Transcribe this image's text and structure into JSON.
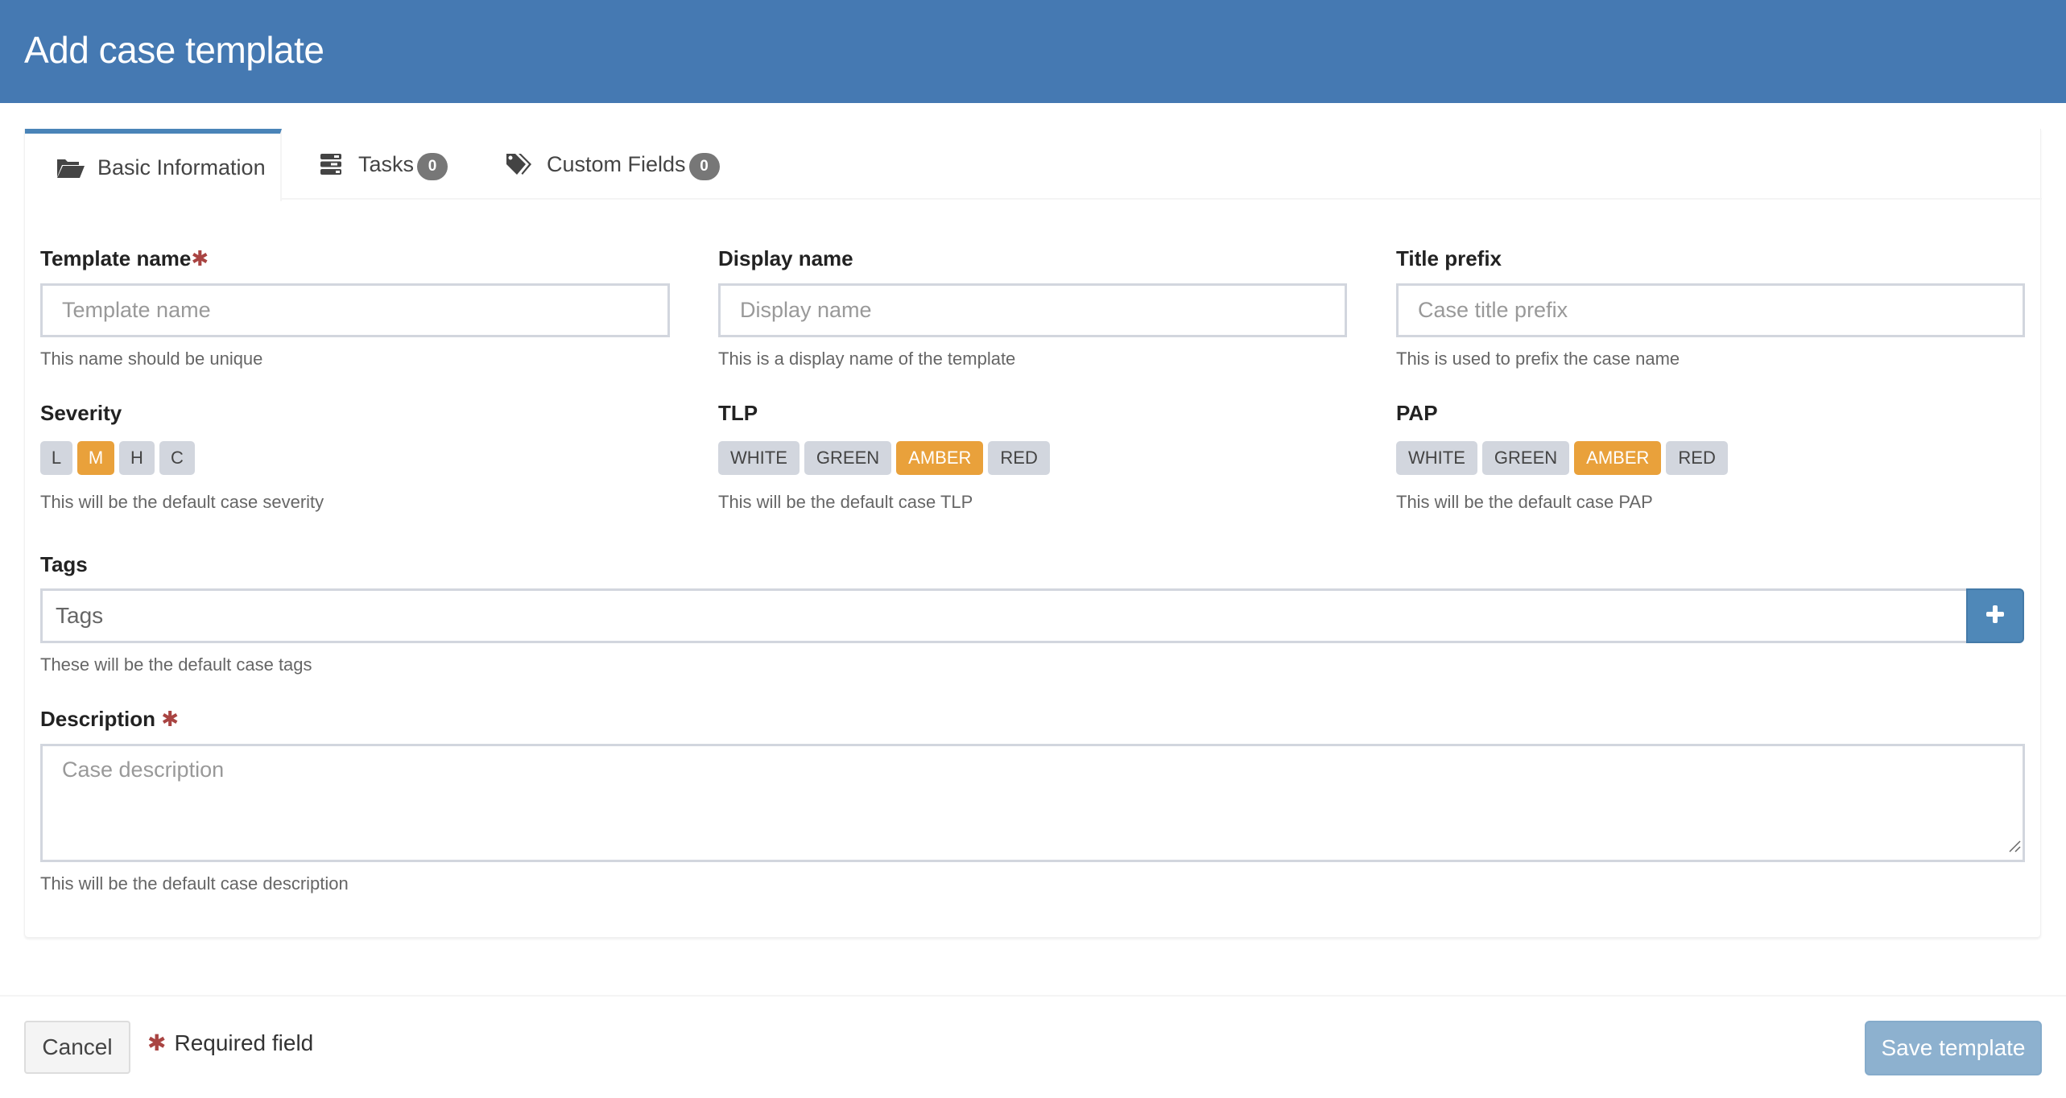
{
  "header": {
    "title": "Add case template"
  },
  "tabs": [
    {
      "label": "Basic Information",
      "icon": "folder-open-icon",
      "active": true
    },
    {
      "label": "Tasks",
      "icon": "tasks-icon",
      "count": "0",
      "active": false
    },
    {
      "label": "Custom Fields",
      "icon": "tags-icon",
      "count": "0",
      "active": false
    }
  ],
  "fields": {
    "template_name": {
      "label": "Template name",
      "required_mark": "✱",
      "placeholder": "Template name",
      "value": "",
      "help": "This name should be unique"
    },
    "display_name": {
      "label": "Display name",
      "placeholder": "Display name",
      "value": "",
      "help": "This is a display name of the template"
    },
    "title_prefix": {
      "label": "Title prefix",
      "placeholder": "Case title prefix",
      "value": "",
      "help": "This is used to prefix the case name"
    },
    "severity": {
      "label": "Severity",
      "options": [
        "L",
        "M",
        "H",
        "C"
      ],
      "selected": "M",
      "help": "This will be the default case severity"
    },
    "tlp": {
      "label": "TLP",
      "options": [
        "WHITE",
        "GREEN",
        "AMBER",
        "RED"
      ],
      "selected": "AMBER",
      "help": "This will be the default case TLP"
    },
    "pap": {
      "label": "PAP",
      "options": [
        "WHITE",
        "GREEN",
        "AMBER",
        "RED"
      ],
      "selected": "AMBER",
      "help": "This will be the default case PAP"
    },
    "tags": {
      "label": "Tags",
      "placeholder": "Tags",
      "value": "",
      "add_icon": "plus-icon",
      "help": "These will be the default case tags"
    },
    "description": {
      "label": "Description",
      "required_mark": "✱",
      "placeholder": "Case description",
      "value": "",
      "help": "This will be the default case description"
    }
  },
  "footer": {
    "cancel_label": "Cancel",
    "required_mark": "✱",
    "required_note": "Required field",
    "save_label": "Save template"
  },
  "colors": {
    "header_bg": "#4579b2",
    "accent": "#4a84b8",
    "selected_badge": "#e9a13b",
    "badge_default": "#d2d6de",
    "required": "#a94442",
    "save_disabled": "#8db1cf"
  }
}
